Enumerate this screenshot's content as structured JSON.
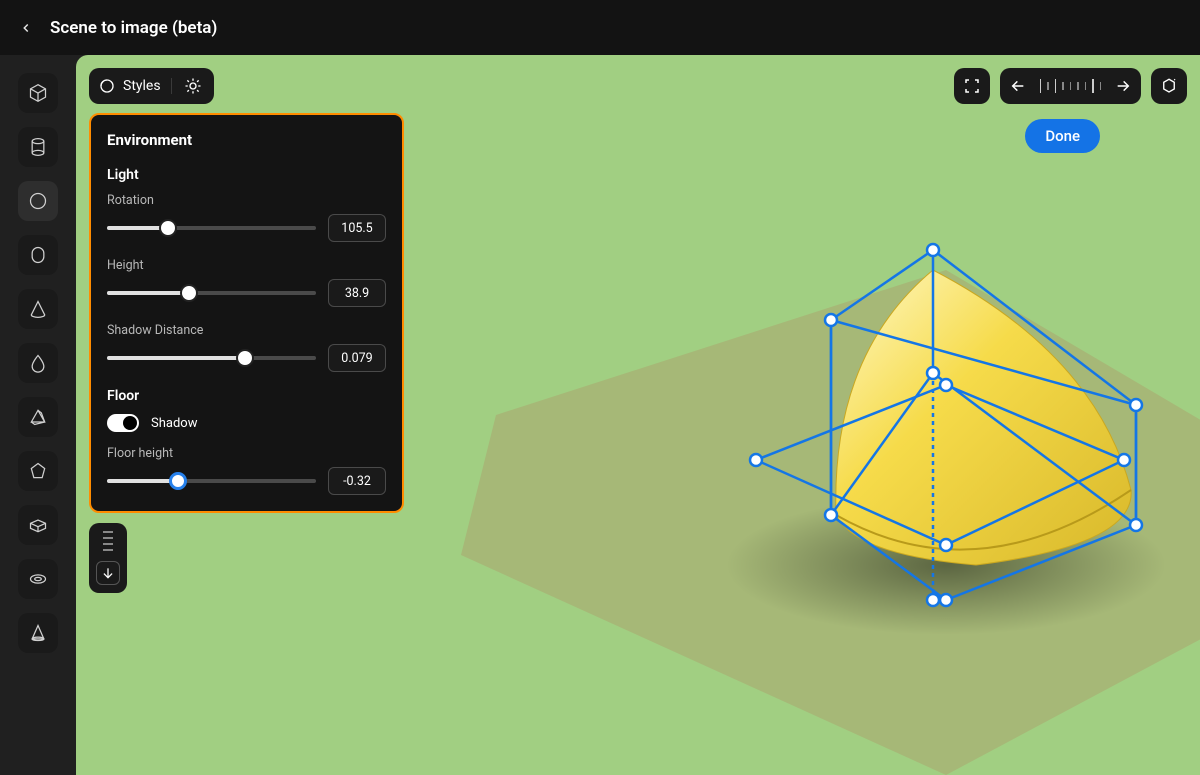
{
  "header": {
    "title": "Scene to image (beta)"
  },
  "toolbar": {
    "styles_label": "Styles"
  },
  "actions": {
    "done_label": "Done"
  },
  "panel": {
    "title": "Environment",
    "light": {
      "title": "Light",
      "rotation": {
        "label": "Rotation",
        "value": "105.5",
        "percent": 29
      },
      "height": {
        "label": "Height",
        "value": "38.9",
        "percent": 39
      },
      "shadow": {
        "label": "Shadow Distance",
        "value": "0.079",
        "percent": 66
      }
    },
    "floor": {
      "title": "Floor",
      "shadow_toggle": {
        "label": "Shadow",
        "on": true
      },
      "height": {
        "label": "Floor height",
        "value": "-0.32",
        "percent": 34
      }
    }
  },
  "sidebar": {
    "tools": [
      "cube",
      "cylinder",
      "sphere",
      "capsule",
      "cone",
      "drop",
      "prism",
      "polyhedron",
      "brick",
      "torus",
      "half-cone"
    ]
  },
  "colors": {
    "canvas_bg": "#a1cf82",
    "floor": "#a6b877",
    "object": "#f2d13e",
    "accent": "#1473e6",
    "panel_border": "#ff8c00"
  }
}
